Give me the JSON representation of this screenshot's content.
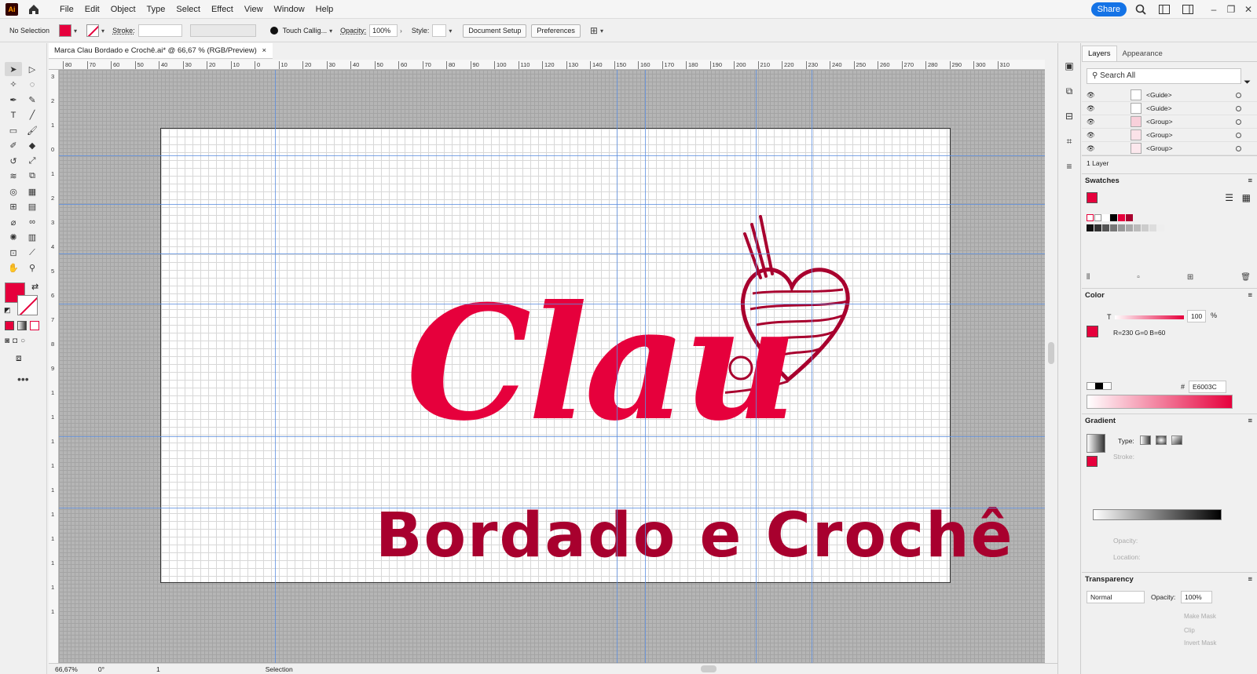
{
  "app": {
    "logo": "Ai"
  },
  "menu": [
    "File",
    "Edit",
    "Object",
    "Type",
    "Select",
    "Effect",
    "View",
    "Window",
    "Help"
  ],
  "menubar_right": {
    "share": "Share"
  },
  "control_bar": {
    "selection": "No Selection",
    "stroke_label": "Stroke:",
    "brush": "Touch Callig...",
    "opacity_label": "Opacity:",
    "opacity_value": "100%",
    "style_label": "Style:",
    "document_setup": "Document Setup",
    "preferences": "Preferences"
  },
  "document": {
    "tab_title": "Marca Clau Bordado e Crochê.ai* @ 66,67 % (RGB/Preview)",
    "close": "×"
  },
  "ruler": {
    "h_ticks": [
      "80",
      "70",
      "60",
      "50",
      "40",
      "30",
      "20",
      "10",
      "0",
      "10",
      "20",
      "30",
      "40",
      "50",
      "60",
      "70",
      "80",
      "90",
      "100",
      "110",
      "120",
      "130",
      "140",
      "150",
      "160",
      "170",
      "180",
      "190",
      "200",
      "210",
      "220",
      "230",
      "240",
      "250",
      "260",
      "270",
      "280",
      "290",
      "300",
      "310"
    ],
    "v_ticks": [
      "3",
      "2",
      "1",
      "0",
      "1",
      "2",
      "3",
      "4",
      "5",
      "6",
      "7",
      "8",
      "9",
      "1",
      "1",
      "1",
      "1",
      "1",
      "1",
      "1",
      "1",
      "1",
      "1"
    ]
  },
  "artwork": {
    "title": "Clau",
    "subtitle": "Bordado e Crochê",
    "primary_color": "#e6003c",
    "secondary_color": "#a8002e"
  },
  "status_bar": {
    "zoom": "66,67%",
    "rotation": "0°",
    "artboard": "1",
    "tool": "Selection"
  },
  "panels": {
    "tabs": [
      "Layers",
      "Appearance"
    ],
    "search_placeholder": "Search All",
    "layers": [
      {
        "name": "<Guide>"
      },
      {
        "name": "<Guide>"
      },
      {
        "name": "<Group>"
      },
      {
        "name": "<Group>"
      },
      {
        "name": "<Group>"
      }
    ],
    "layer_count": "1 Layer",
    "swatches_title": "Swatches",
    "color_title": "Color",
    "color_t_label": "T",
    "color_value": "100",
    "color_percent": "%",
    "rgb": "R=230 G=0 B=60",
    "hex_label": "#",
    "hex": "E6003C",
    "gradient_title": "Gradient",
    "gradient_type": "Type:",
    "gradient_stroke": "Stroke:",
    "gradient_opacity": "Opacity:",
    "gradient_location": "Location:",
    "transparency_title": "Transparency",
    "blend_mode": "Normal",
    "t_opacity_label": "Opacity:",
    "t_opacity_value": "100%",
    "make_mask": "Make Mask",
    "clip": "Clip",
    "invert_mask": "Invert Mask"
  }
}
